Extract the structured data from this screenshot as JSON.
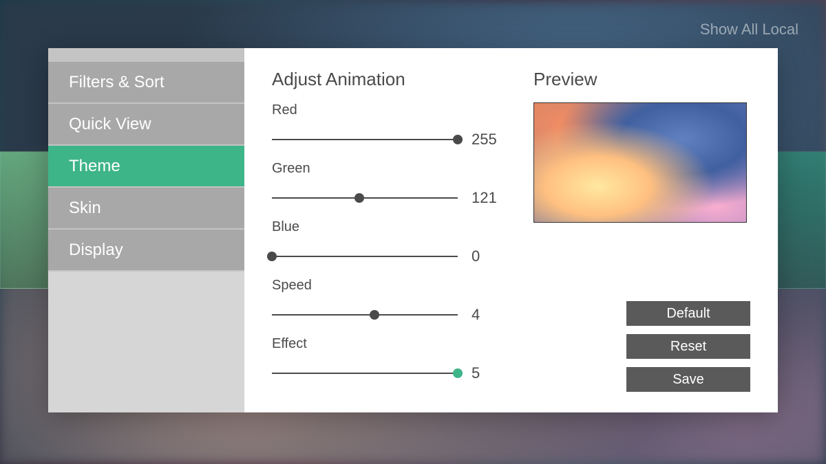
{
  "header": {
    "show_all_local": "Show All Local"
  },
  "sidebar": {
    "items": [
      {
        "label": "Filters & Sort",
        "active": false
      },
      {
        "label": "Quick View",
        "active": false
      },
      {
        "label": "Theme",
        "active": true
      },
      {
        "label": "Skin",
        "active": false
      },
      {
        "label": "Display",
        "active": false
      }
    ]
  },
  "main": {
    "title": "Adjust Animation",
    "sliders": [
      {
        "label": "Red",
        "value": 255,
        "max": 255,
        "pct": 100,
        "accent": false
      },
      {
        "label": "Green",
        "value": 121,
        "max": 255,
        "pct": 47,
        "accent": false
      },
      {
        "label": "Blue",
        "value": 0,
        "max": 255,
        "pct": 0,
        "accent": false
      },
      {
        "label": "Speed",
        "value": 4,
        "max": 10,
        "pct": 55,
        "accent": false
      },
      {
        "label": "Effect",
        "value": 5,
        "max": 5,
        "pct": 100,
        "accent": true
      }
    ]
  },
  "preview": {
    "title": "Preview"
  },
  "buttons": {
    "default": "Default",
    "reset": "Reset",
    "save": "Save"
  }
}
